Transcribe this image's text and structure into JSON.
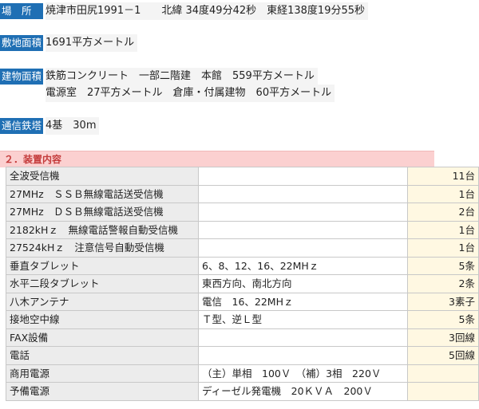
{
  "site": {
    "location_label": "場　所",
    "location_value": "焼津市田尻1991－1　　北緯 34度49分42秒　東経138度19分55秒",
    "area_label": "敷地面積",
    "area_value": "1691平方メートル",
    "building_label": "建物面積",
    "building_line1": "鉄筋コンクリート　一部二階建　本館　559平方メートル",
    "building_line2": "電源室　27平方メートル　倉庫・付属建物　60平方メートル",
    "tower_label": "通信鉄塔",
    "tower_value": "4基　30m"
  },
  "section": {
    "title": "２．装置内容"
  },
  "equipment": [
    {
      "name": "全波受信機",
      "spec": "",
      "qty": "11台"
    },
    {
      "name": "27MHz　ＳＳＢ無線電話送受信機",
      "spec": "",
      "qty": "1台"
    },
    {
      "name": "27MHz　ＤＳＢ無線電話送受信機",
      "spec": "",
      "qty": "2台"
    },
    {
      "name": "2182kHｚ　無線電話警報自動受信機",
      "spec": "",
      "qty": "1台"
    },
    {
      "name": "27524kHｚ　注意信号自動受信機",
      "spec": "",
      "qty": "1台"
    },
    {
      "name": "垂直タブレット",
      "spec": "6、8、12、16、22MHｚ",
      "qty": "5条"
    },
    {
      "name": "水平二段タブレット",
      "spec": "東西方向、南北方向",
      "qty": "2条"
    },
    {
      "name": "八木アンテナ",
      "spec": "電信　16、22MHｚ",
      "qty": "3素子"
    },
    {
      "name": "接地空中線",
      "spec": "Ｔ型、逆Ｌ型",
      "qty": "5条"
    },
    {
      "name": "FAX設備",
      "spec": "",
      "qty": "3回線"
    },
    {
      "name": "電話",
      "spec": "",
      "qty": "5回線"
    },
    {
      "name": "商用電源",
      "spec": "（主）単相　100Ｖ　（補）3相　220Ｖ",
      "qty": ""
    },
    {
      "name": "予備電源",
      "spec": "ディーゼル発電機　20ＫＶＡ　200Ｖ",
      "qty": ""
    }
  ]
}
